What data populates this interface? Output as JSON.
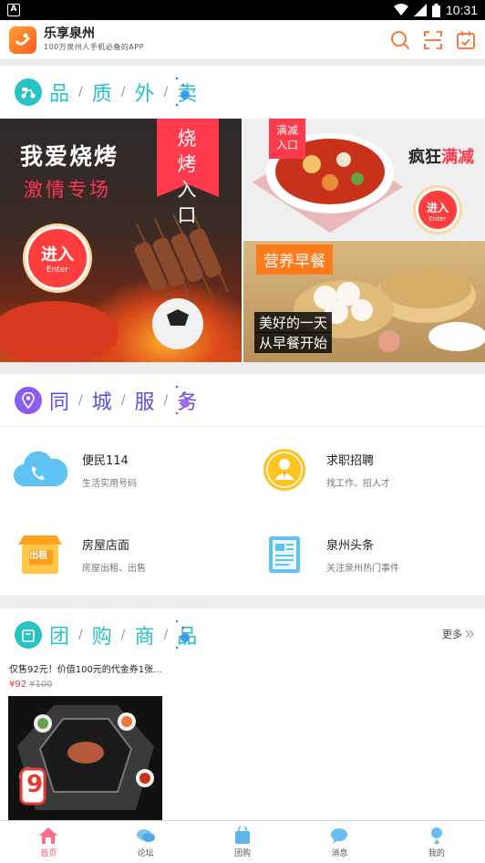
{
  "status_bar": {
    "time": "10:31",
    "notification_icon": "A"
  },
  "header": {
    "app_name": "乐享泉州",
    "slogan": "100万泉州人手机必备的APP",
    "icons": [
      "search-icon",
      "scan-icon",
      "checkin-icon"
    ]
  },
  "food_section": {
    "title_chars": [
      "品",
      "质",
      "外",
      "卖"
    ],
    "icon": "scooter-icon",
    "banners": {
      "bbq": {
        "line1": "我爱烧烤",
        "line2": "激情专场",
        "tag": "烧烤入口",
        "enter": "进入",
        "enter_en": "Enter"
      },
      "discount": {
        "tag": "满减入口",
        "title_prefix": "疯狂",
        "title_highlight": "满减",
        "enter": "进入",
        "enter_en": "Enter"
      },
      "breakfast": {
        "tag": "营养早餐",
        "line1": "美好的一天",
        "line2": "从早餐开始"
      }
    }
  },
  "city_section": {
    "title_chars": [
      "同",
      "城",
      "服",
      "务"
    ],
    "icon": "location-icon",
    "services": [
      {
        "name": "便民114",
        "desc": "生活实用号码",
        "icon": "phone-cloud-icon"
      },
      {
        "name": "求职招聘",
        "desc": "找工作、招人才",
        "icon": "job-person-icon"
      },
      {
        "name": "房屋店面",
        "desc": "房屋出租、出售",
        "icon": "house-rent-icon",
        "badge": "出租"
      },
      {
        "name": "泉州头条",
        "desc": "关注泉州热门事件",
        "icon": "news-icon"
      }
    ]
  },
  "group_section": {
    "title_chars": [
      "团",
      "购",
      "商",
      "品"
    ],
    "icon": "shopping-bag-icon",
    "more": "更多",
    "product": {
      "title": "仅售92元！价值100元的代金券1张...",
      "price": "¥92",
      "original_price": "¥100",
      "image_text": "9"
    }
  },
  "tabs": [
    {
      "label": "首页",
      "icon": "home-icon",
      "active": true
    },
    {
      "label": "论坛",
      "icon": "forum-icon",
      "active": false
    },
    {
      "label": "团购",
      "icon": "group-buy-icon",
      "active": false
    },
    {
      "label": "消息",
      "icon": "message-icon",
      "active": false
    },
    {
      "label": "我的",
      "icon": "profile-icon",
      "active": false
    }
  ],
  "colors": {
    "accent": "#ff4b6e",
    "teal": "#28c3c3",
    "purple": "#8a5cf0",
    "blue": "#2c8be8"
  }
}
